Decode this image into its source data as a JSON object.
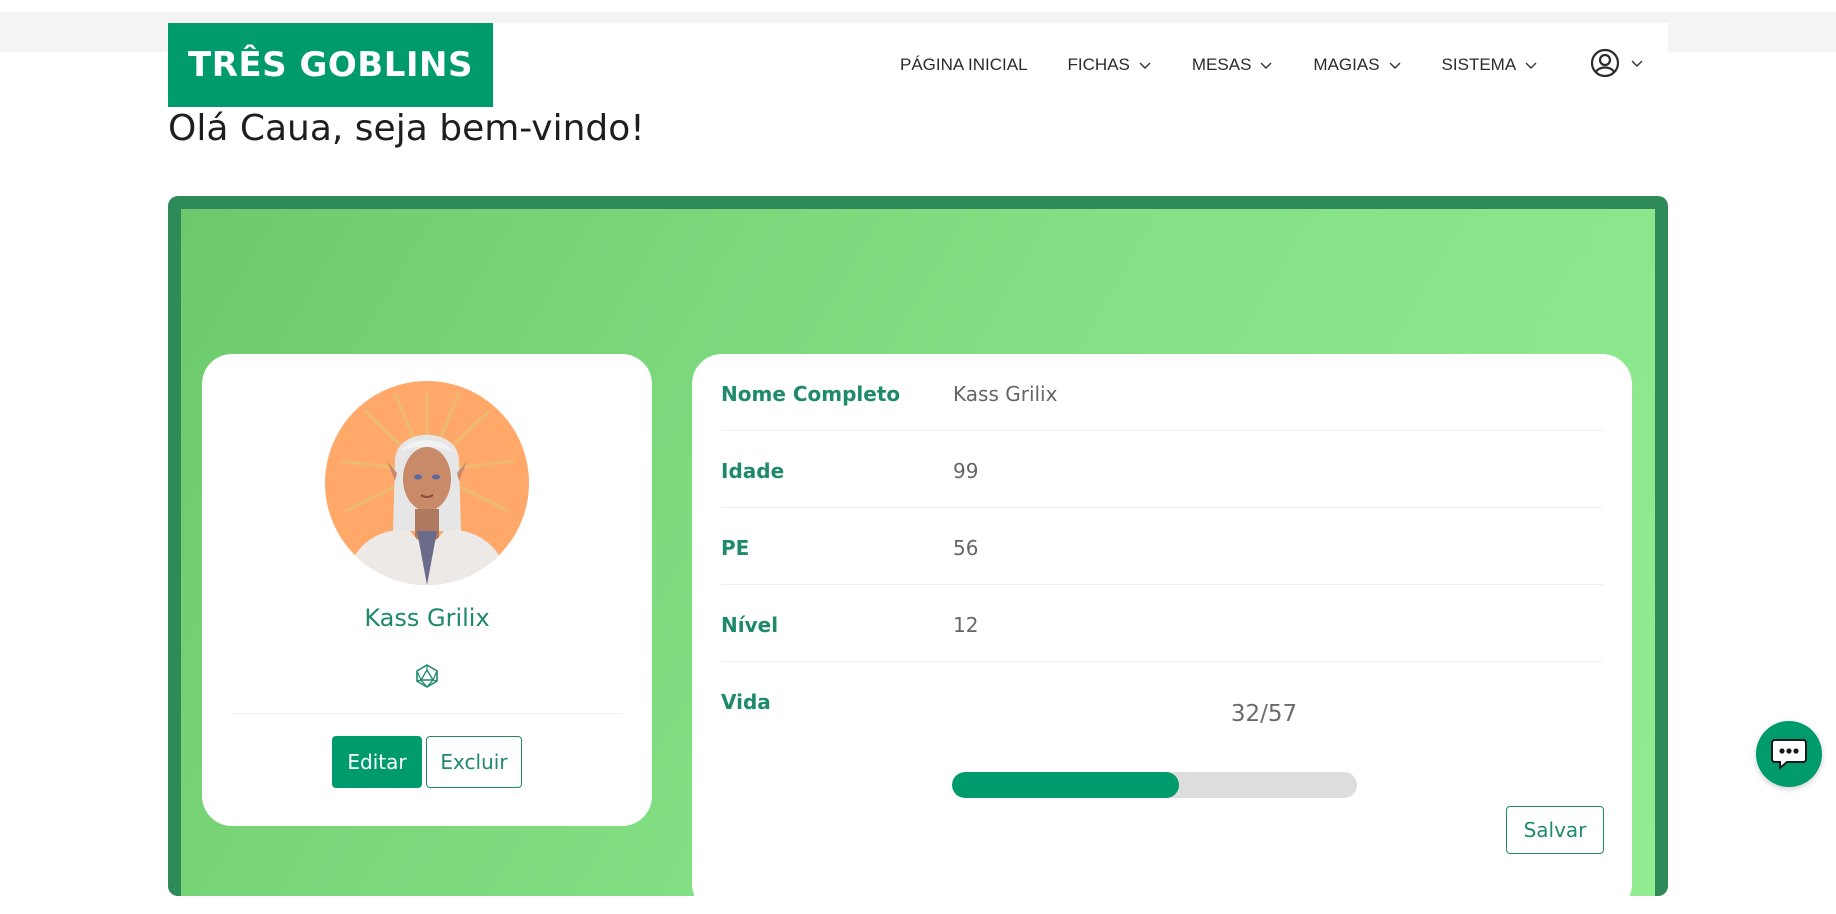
{
  "brand": {
    "name": "TRÊS GOBLINS",
    "color": "#009b6c"
  },
  "nav": {
    "items": [
      {
        "label": "PÁGINA INICIAL",
        "dropdown": false
      },
      {
        "label": "FICHAS",
        "dropdown": true
      },
      {
        "label": "MESAS",
        "dropdown": true
      },
      {
        "label": "MAGIAS",
        "dropdown": true
      },
      {
        "label": "SISTEMA",
        "dropdown": true
      }
    ],
    "user_icon": "user-circle-icon"
  },
  "greeting": "Olá Caua, seja bem-vindo!",
  "character": {
    "name": "Kass Grilix",
    "icon": "d20-icon",
    "edit_label": "Editar",
    "delete_label": "Excluir"
  },
  "details": {
    "rows": [
      {
        "label": "Nome Completo",
        "value": "Kass Grilix"
      },
      {
        "label": "Idade",
        "value": "99"
      },
      {
        "label": "PE",
        "value": "56"
      },
      {
        "label": "Nível",
        "value": "12"
      }
    ],
    "hp": {
      "label": "Vida",
      "text": "32/57",
      "current": 32,
      "max": 57
    },
    "save_label": "Salvar"
  },
  "chat": {
    "icon": "chat-bubble-icon"
  },
  "colors": {
    "accent": "#009b6c",
    "panel_border": "#2f8a5a",
    "label_green": "#1e8a6a"
  }
}
